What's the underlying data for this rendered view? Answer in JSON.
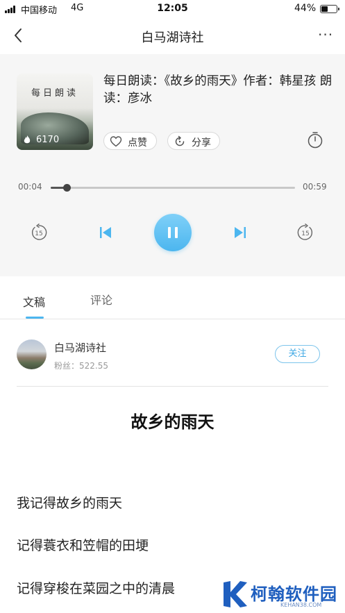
{
  "status_bar": {
    "carrier": "中国移动",
    "network": "4G",
    "time": "12:05",
    "battery_percent": "44%",
    "battery_level": 0.44
  },
  "nav": {
    "title": "白马湖诗社",
    "back_icon": "chevron-left-icon",
    "more_icon": "more-dots-icon",
    "more_label": "···"
  },
  "player": {
    "cover_text": "每日朗读",
    "play_count": "6170",
    "track_title": "每日朗读：《故乡的雨天》作者：韩星孩 朗读：彦冰",
    "like_label": "点赞",
    "share_label": "分享",
    "current_time": "00:04",
    "duration": "00:59",
    "progress": 0.068,
    "rewind_label": "15",
    "forward_label": "15",
    "accent_color": "#4cb6ef"
  },
  "tabs": [
    {
      "label": "文稿",
      "active": true
    },
    {
      "label": "评论",
      "active": false
    }
  ],
  "author": {
    "name": "白马湖诗社",
    "fans": "粉丝：522.55",
    "follow_label": "关注"
  },
  "article": {
    "title": "故乡的雨天",
    "lines": [
      "我记得故乡的雨天",
      "记得蓑衣和笠帽的田埂",
      "记得穿梭在菜园之中的清晨"
    ]
  },
  "watermark": {
    "name": "柯翰软件园",
    "domain": "KEHAN38.COM"
  }
}
